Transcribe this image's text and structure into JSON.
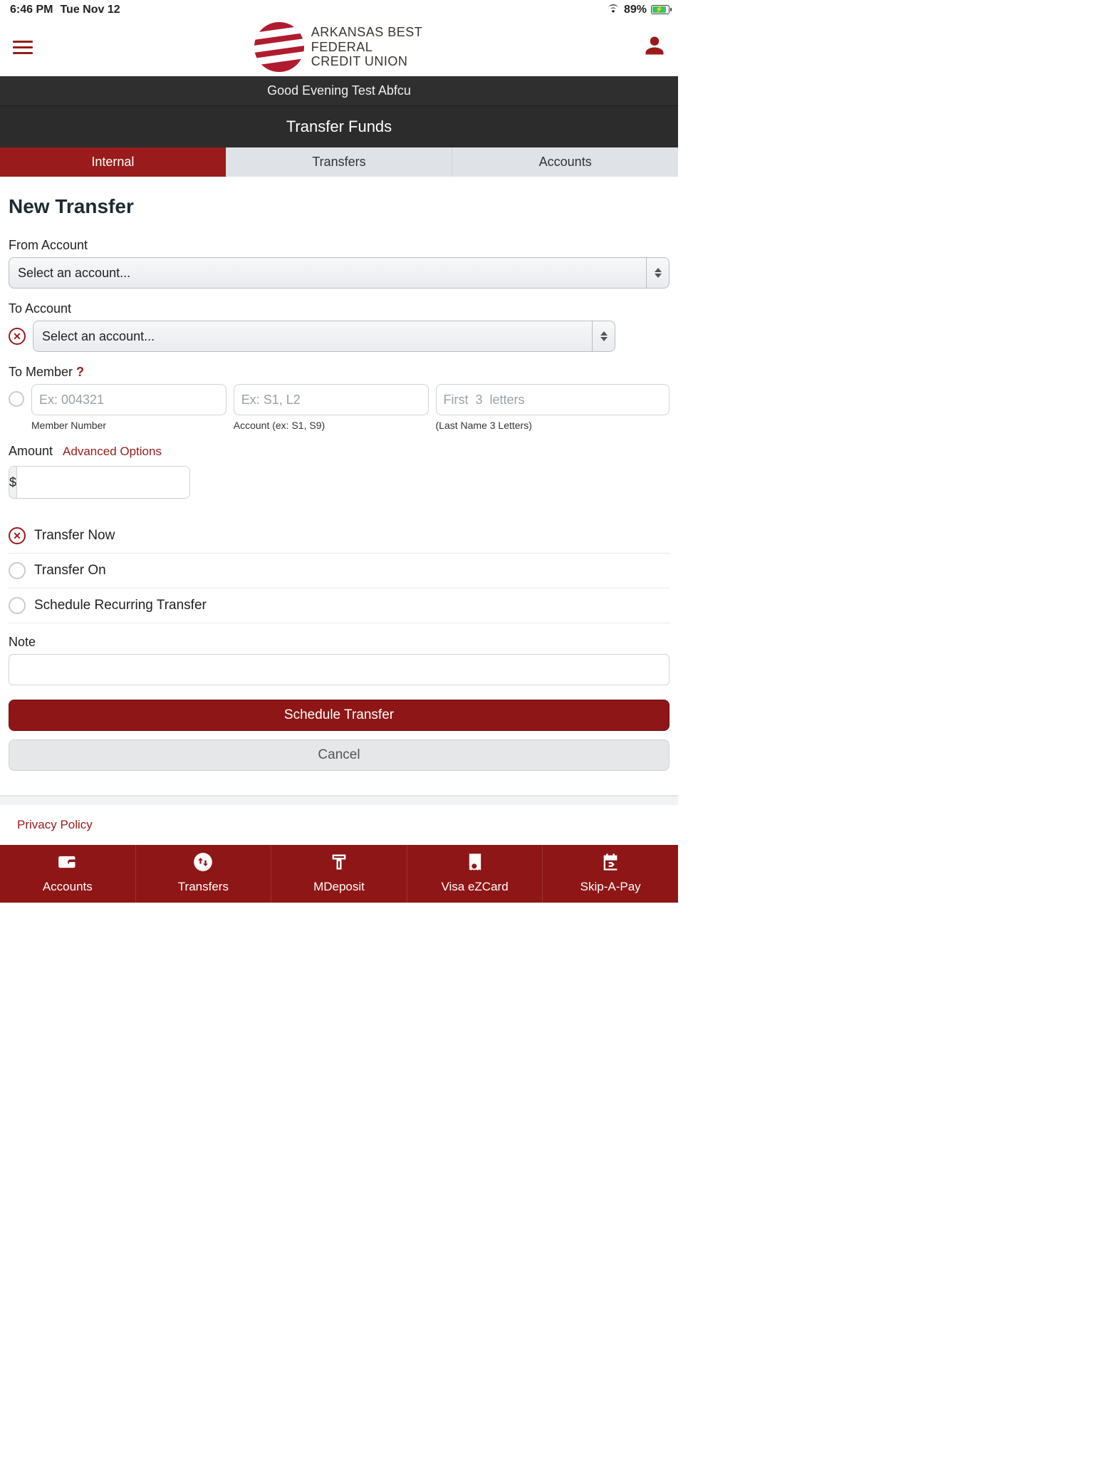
{
  "status": {
    "time": "6:46 PM",
    "date": "Tue Nov 12",
    "battery": "89%"
  },
  "brand": {
    "line1": "ARKANSAS BEST",
    "line2": "FEDERAL",
    "line3": "CREDIT UNION"
  },
  "greeting": "Good Evening Test Abfcu",
  "page_title": "Transfer Funds",
  "tabs": {
    "internal": "Internal",
    "transfers": "Transfers",
    "accounts": "Accounts"
  },
  "form": {
    "heading": "New Transfer",
    "from_label": "From Account",
    "from_placeholder": "Select an account...",
    "to_label": "To Account",
    "to_placeholder": "Select an account...",
    "to_member_label": "To Member",
    "to_member_help": "?",
    "member_number_placeholder": "Ex: 004321",
    "member_number_sub": "Member Number",
    "member_account_placeholder": "Ex: S1, L2",
    "member_account_sub": "Account (ex: S1, S9)",
    "member_last_placeholder": "First  3  letters",
    "member_last_sub": "(Last Name  3  Letters)",
    "amount_label": "Amount",
    "advanced_options": "Advanced Options",
    "currency_symbol": "$",
    "opt_now": "Transfer Now",
    "opt_on": "Transfer On",
    "opt_recurring": "Schedule Recurring Transfer",
    "note_label": "Note",
    "submit": "Schedule Transfer",
    "cancel": "Cancel"
  },
  "footer": {
    "privacy": "Privacy Policy"
  },
  "nav": {
    "accounts": "Accounts",
    "transfers": "Transfers",
    "mdeposit": "MDeposit",
    "visa": "Visa eZCard",
    "skip": "Skip-A-Pay"
  }
}
